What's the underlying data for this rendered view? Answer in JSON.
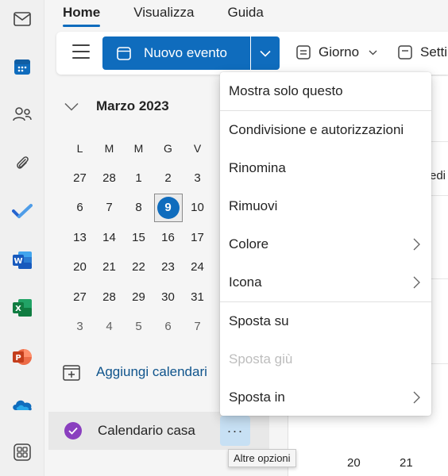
{
  "tabs": [
    {
      "label": "Home"
    },
    {
      "label": "Visualizza"
    },
    {
      "label": "Guida"
    }
  ],
  "ribbon": {
    "new_event": "Nuovo evento",
    "view_day": "Giorno",
    "settings_partial": "Setti"
  },
  "mini_calendar": {
    "month": "Marzo 2023",
    "weekdays": [
      "L",
      "M",
      "M",
      "G",
      "V"
    ],
    "rows": [
      [
        "27",
        "28",
        "1",
        "2",
        "3"
      ],
      [
        "6",
        "7",
        "8",
        "9",
        "10"
      ],
      [
        "13",
        "14",
        "15",
        "16",
        "17"
      ],
      [
        "20",
        "21",
        "22",
        "23",
        "24"
      ],
      [
        "27",
        "28",
        "29",
        "30",
        "31"
      ],
      [
        "3",
        "4",
        "5",
        "6",
        "7"
      ]
    ],
    "today": "9"
  },
  "sidebar": {
    "add_calendar": "Aggiungi calendari",
    "calendar_name": "Calendario casa",
    "calendar_color": "#8a3fbf",
    "more_options_glyph": "···"
  },
  "tooltip": "Altre opzioni",
  "grid": {
    "day_partial": "edi",
    "bottom_left": "20",
    "bottom_right": "21"
  },
  "menu": {
    "items": [
      {
        "label": "Mostra solo questo"
      },
      {
        "label": "Condivisione e autorizzazioni"
      },
      {
        "label": "Rinomina"
      },
      {
        "label": "Rimuovi"
      },
      {
        "label": "Colore"
      },
      {
        "label": "Icona"
      },
      {
        "label": "Sposta su"
      },
      {
        "label": "Sposta giù"
      },
      {
        "label": "Sposta in"
      }
    ]
  },
  "colors": {
    "accent": "#0f6cbd",
    "tooltip_bg": "#c7e0f4"
  }
}
